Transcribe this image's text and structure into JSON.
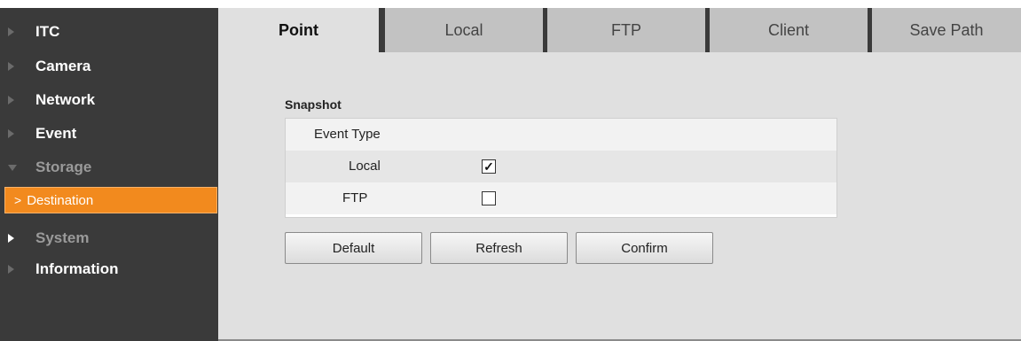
{
  "sidebar": {
    "items": [
      {
        "label": "ITC"
      },
      {
        "label": "Camera"
      },
      {
        "label": "Network"
      },
      {
        "label": "Event"
      },
      {
        "label": "Storage"
      },
      {
        "label": "System"
      },
      {
        "label": "Information"
      }
    ],
    "sub_items": [
      {
        "label": "Destination",
        "active": true
      }
    ],
    "sub_chevron": ">"
  },
  "tabs": [
    {
      "label": "Point",
      "active": true
    },
    {
      "label": "Local"
    },
    {
      "label": "FTP"
    },
    {
      "label": "Client"
    },
    {
      "label": "Save Path"
    }
  ],
  "snapshot": {
    "title": "Snapshot",
    "header": "Event Type",
    "rows": [
      {
        "label": "Local",
        "checked": true,
        "mark": "✓"
      },
      {
        "label": "FTP",
        "checked": false,
        "mark": ""
      }
    ]
  },
  "buttons": {
    "default_label": "Default",
    "refresh_label": "Refresh",
    "confirm_label": "Confirm"
  },
  "colors": {
    "sidebar_bg": "#3a3a3a",
    "active_item": "#f28a1e",
    "content_bg": "#e0e0e0",
    "tab_inactive": "#c2c2c2"
  }
}
